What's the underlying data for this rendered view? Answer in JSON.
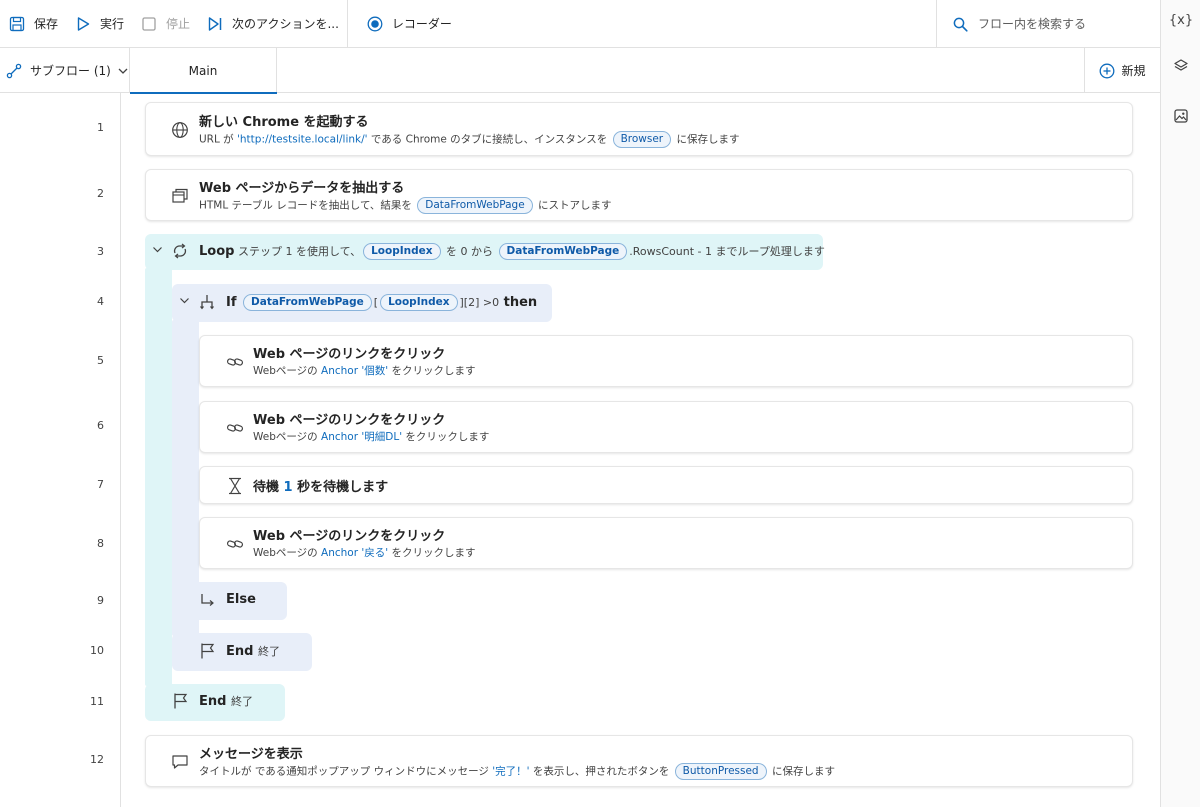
{
  "toolbar": {
    "save": "保存",
    "run": "実行",
    "stop": "停止",
    "next_action": "次のアクションを...",
    "recorder": "レコーダー",
    "search_placeholder": "フロー内を検索する"
  },
  "rail": {
    "variables_label": "{x}"
  },
  "tabs": {
    "subflow": "サブフロー (1)",
    "main": "Main",
    "new": "新規"
  },
  "accent_color": "#0f6cbd",
  "line_numbers": [
    "1",
    "2",
    "3",
    "4",
    "5",
    "6",
    "7",
    "8",
    "9",
    "10",
    "11",
    "12"
  ],
  "actions": {
    "a1": {
      "title": "新しい Chrome を起動する",
      "d_pre": "URL が ",
      "d_url": "'http://testsite.local/link/'",
      "d_mid": " である Chrome のタブに接続し、インスタンスを ",
      "d_var": "Browser",
      "d_post": " に保存します"
    },
    "a2": {
      "title": "Web ページからデータを抽出する",
      "d_pre": "HTML テーブル レコードを抽出して、結果を ",
      "d_var": "DataFromWebPage",
      "d_post": " にストアします"
    },
    "a3": {
      "title": "Loop",
      "d_1": " ステップ ",
      "d_step": "1",
      "d_2": " を使用して、",
      "d_var": "LoopIndex",
      "d_3": " を ",
      "d_from": "0",
      "d_4": " から ",
      "d_var2": "DataFromWebPage",
      "d_prop": ".RowsCount - 1",
      "d_5": " までループ処理します"
    },
    "a4": {
      "title": "If",
      "var1": "DataFromWebPage",
      "b1": "[",
      "var2": "LoopIndex",
      "b2": "][2]",
      "op": " >",
      "val": "0",
      "then": " then"
    },
    "a5": {
      "title": "Web ページのリンクをクリック",
      "d_pre": "Webページの ",
      "d_hl": "Anchor '個数'",
      "d_post": " をクリックします"
    },
    "a6": {
      "title": "Web ページのリンクをクリック",
      "d_pre": "Webページの ",
      "d_hl": "Anchor '明細DL'",
      "d_post": " をクリックします"
    },
    "a7": {
      "title": "待機",
      "d_val": "1",
      "d_post": " 秒を待機します"
    },
    "a8": {
      "title": "Web ページのリンクをクリック",
      "d_pre": "Webページの ",
      "d_hl": "Anchor '戻る'",
      "d_post": " をクリックします"
    },
    "a9": {
      "title": "Else"
    },
    "a10": {
      "title": "End",
      "sub": "終了"
    },
    "a11": {
      "title": "End",
      "sub": "終了"
    },
    "a12": {
      "title": "メッセージを表示",
      "d_pre": "タイトルが  である通知ポップアップ ウィンドウにメッセージ ",
      "d_msg": "'完了！'",
      "d_mid": " を表示し、押されたボタンを ",
      "d_var": "ButtonPressed",
      "d_post": " に保存します"
    }
  }
}
